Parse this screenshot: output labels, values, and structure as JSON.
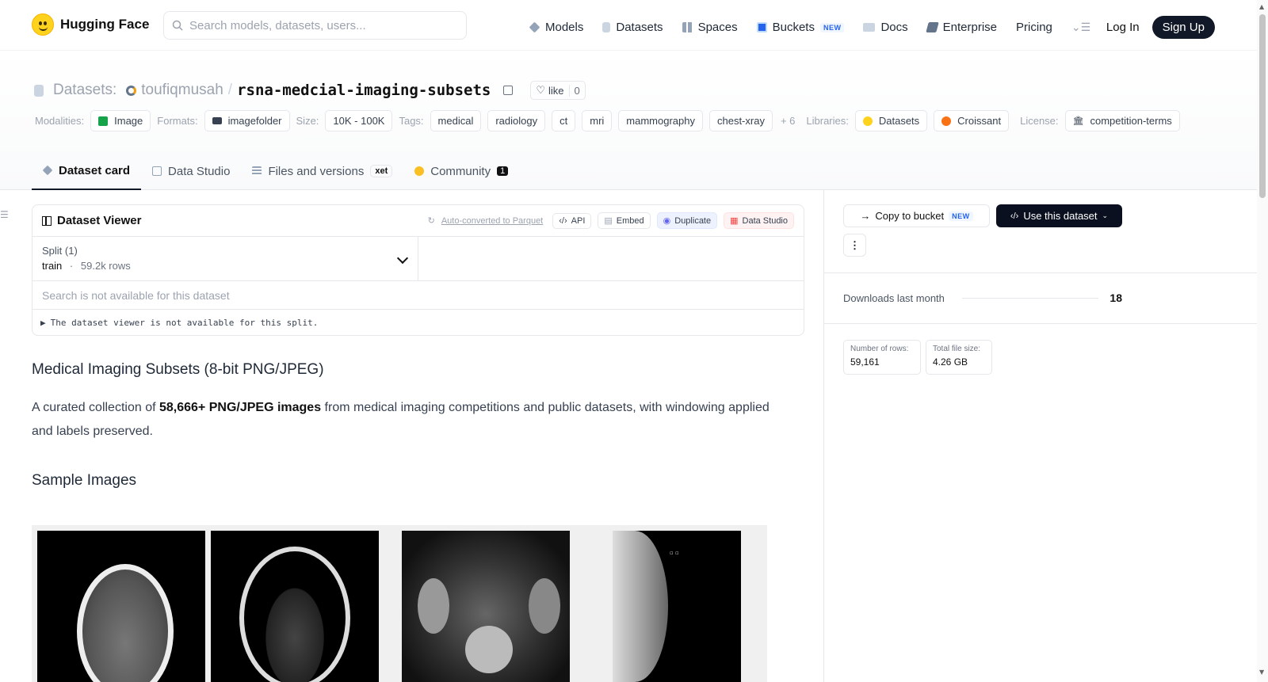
{
  "nav": {
    "brand": "Hugging Face",
    "search_placeholder": "Search models, datasets, users...",
    "items": [
      {
        "label": "Models",
        "icon": "cube-icon",
        "color": "#94a3b8"
      },
      {
        "label": "Datasets",
        "icon": "database-icon",
        "color": "#cbd5e1"
      },
      {
        "label": "Spaces",
        "icon": "grid-icon",
        "color": "#94a3b8"
      },
      {
        "label": "Buckets",
        "icon": "bucket-icon",
        "color": "#2563eb",
        "badge": "NEW"
      },
      {
        "label": "Docs",
        "icon": "book-icon",
        "color": "#94a3b8"
      },
      {
        "label": "Enterprise",
        "icon": "enterprise-icon",
        "color": "#64748b"
      },
      {
        "label": "Pricing"
      }
    ],
    "login": "Log In",
    "signup": "Sign Up"
  },
  "header": {
    "crumb_label": "Datasets:",
    "owner": "toufiqmusah",
    "separator": "/",
    "repo": "rsna-medcial-imaging-subsets",
    "like_label": "like",
    "like_count": "0"
  },
  "tags": {
    "modalities_label": "Modalities:",
    "modalities": [
      {
        "label": "Image",
        "color": "#16a34a"
      }
    ],
    "formats_label": "Formats:",
    "formats": [
      {
        "label": "imagefolder",
        "color": "#374151"
      }
    ],
    "size_label": "Size:",
    "size": "10K - 100K",
    "tags_label": "Tags:",
    "tags": [
      "medical",
      "radiology",
      "ct",
      "mri",
      "mammography",
      "chest-xray"
    ],
    "more": "+ 6",
    "libraries_label": "Libraries:",
    "libraries": [
      {
        "label": "Datasets",
        "color": "#FFD21E"
      },
      {
        "label": "Croissant",
        "color": "#f97316"
      }
    ],
    "license_label": "License:",
    "license": "competition-terms"
  },
  "tabs": [
    {
      "label": "Dataset card",
      "active": true
    },
    {
      "label": "Data Studio"
    },
    {
      "label": "Files and versions",
      "badge": "xet"
    },
    {
      "label": "Community",
      "count": "1"
    }
  ],
  "viewer": {
    "title": "Dataset Viewer",
    "auto_converted": "Auto-converted to Parquet",
    "api": "API",
    "embed": "Embed",
    "duplicate": "Duplicate",
    "data_studio": "Data Studio",
    "split_label": "Split (1)",
    "split_value": "train",
    "split_dot": "·",
    "split_rows": "59.2k rows",
    "search_unavailable": "Search is not available for this dataset",
    "not_available": "The dataset viewer is not available for this split."
  },
  "card": {
    "title": "Medical Imaging Subsets (8-bit PNG/JPEG)",
    "intro_before": "A curated collection of ",
    "intro_bold": "58,666+ PNG/JPEG images",
    "intro_after": " from medical imaging competitions and public datasets, with windowing applied and labels preserved.",
    "samples_heading": "Sample Images"
  },
  "sidebar": {
    "copy_bucket": "Copy to bucket",
    "copy_bucket_badge": "NEW",
    "use_dataset": "Use this dataset",
    "downloads_label": "Downloads last month",
    "downloads_value": "18",
    "rows_label": "Number of rows:",
    "rows_value": "59,161",
    "size_label": "Total file size:",
    "size_value": "4.26 GB"
  }
}
